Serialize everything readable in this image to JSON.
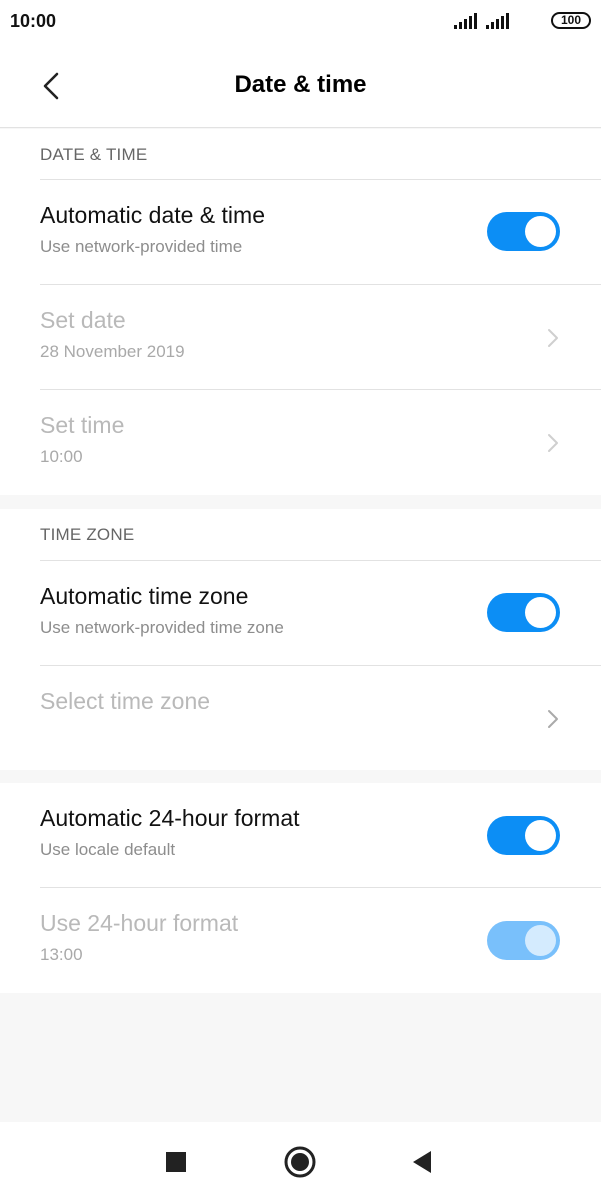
{
  "status_bar": {
    "time": "10:00",
    "battery": "100",
    "icons": [
      "signal-icon",
      "signal-icon",
      "battery-icon"
    ]
  },
  "header": {
    "title": "Date & time",
    "back_icon": "back-arrow-icon"
  },
  "sections": {
    "date_time": {
      "header": "DATE & TIME",
      "rows": [
        {
          "title": "Automatic date & time",
          "subtitle": "Use network-provided time",
          "control": "toggle",
          "enabled": true,
          "on": true
        },
        {
          "title": "Set date",
          "subtitle": "28 November 2019",
          "control": "chevron",
          "enabled": false
        },
        {
          "title": "Set time",
          "subtitle": "10:00",
          "control": "chevron",
          "enabled": false
        }
      ]
    },
    "time_zone": {
      "header": "TIME ZONE",
      "rows": [
        {
          "title": "Automatic time zone",
          "subtitle": "Use network-provided time zone",
          "control": "toggle",
          "enabled": true,
          "on": true
        },
        {
          "title": "Select time zone",
          "subtitle": "",
          "control": "chevron",
          "enabled": false
        }
      ]
    },
    "format": {
      "rows": [
        {
          "title": "Automatic 24-hour format",
          "subtitle": "Use locale default",
          "control": "toggle",
          "enabled": true,
          "on": true
        },
        {
          "title": "Use 24-hour format",
          "subtitle": "13:00",
          "control": "toggle",
          "enabled": false,
          "on": true
        }
      ]
    }
  },
  "nav_bar": {
    "icons": [
      "recents-square-icon",
      "home-circle-icon",
      "back-triangle-icon"
    ]
  },
  "colors": {
    "accent": "#0c8ef5",
    "accent_disabled": "#79c0fb",
    "background": "#f7f7f7",
    "card": "#ffffff"
  }
}
